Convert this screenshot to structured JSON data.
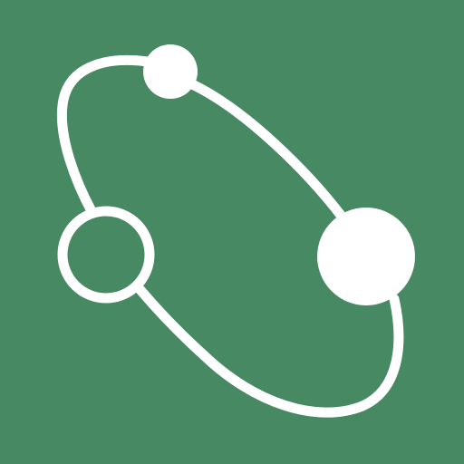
{
  "icon": {
    "name": "orbit-nodes-icon",
    "background_color": "#468962",
    "foreground_color": "#ffffff"
  }
}
